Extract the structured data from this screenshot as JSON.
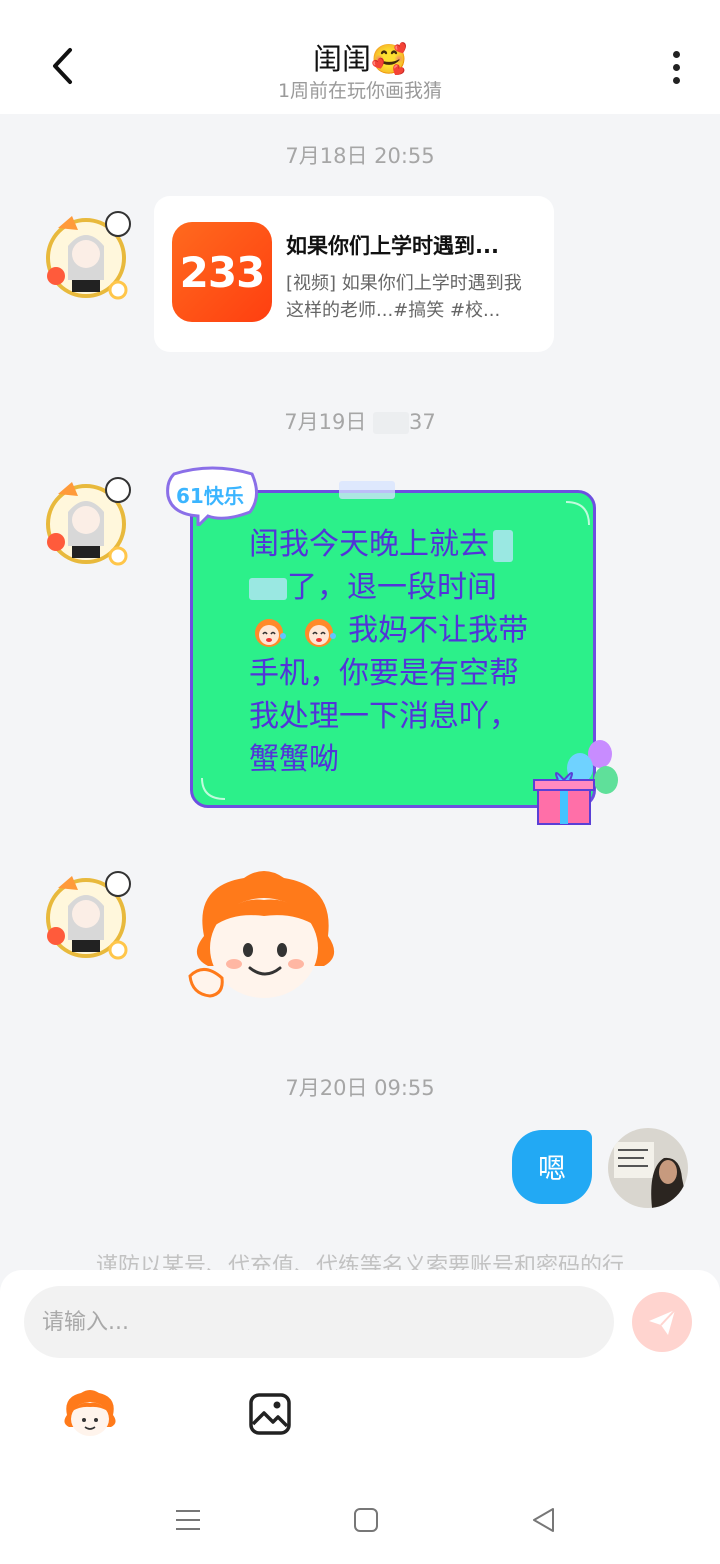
{
  "header": {
    "title": "闺闺🥰",
    "subtitle": "1周前在玩你画我猜",
    "back_icon": "chevron-left-icon",
    "more_icon": "more-vertical-icon"
  },
  "messages": {
    "time1": "7月18日 20:55",
    "share_card": {
      "logo_text": "233",
      "title": "如果你们上学时遇到...",
      "description": "[视频] 如果你们上学时遇到我这样的老师...#搞笑 #校..."
    },
    "time2_prefix": "7月19日",
    "time2_suffix": "37",
    "bubble": {
      "badge_text": "61快乐",
      "line1": "闺我今天晚上就去",
      "line2": "了，退一段时间",
      "line3": "我妈不让我带",
      "line4": "手机，你要是有空帮",
      "line5": "我处理一下消息吖，",
      "line6": "蟹蟹呦"
    },
    "time3": "7月20日 09:55",
    "reply": "嗯"
  },
  "notice": "谨防以某号、代充值、代练等名义索要账号和密码的行",
  "input": {
    "placeholder": "请输入...",
    "send_icon": "send-icon",
    "sticker_icon": "sticker-icon",
    "image_icon": "image-icon"
  },
  "colors": {
    "accent_blue": "#22a9f4",
    "bubble_green": "#2cf08a",
    "bubble_text": "#5234d8",
    "logo_orange": "#ff5a1a"
  }
}
